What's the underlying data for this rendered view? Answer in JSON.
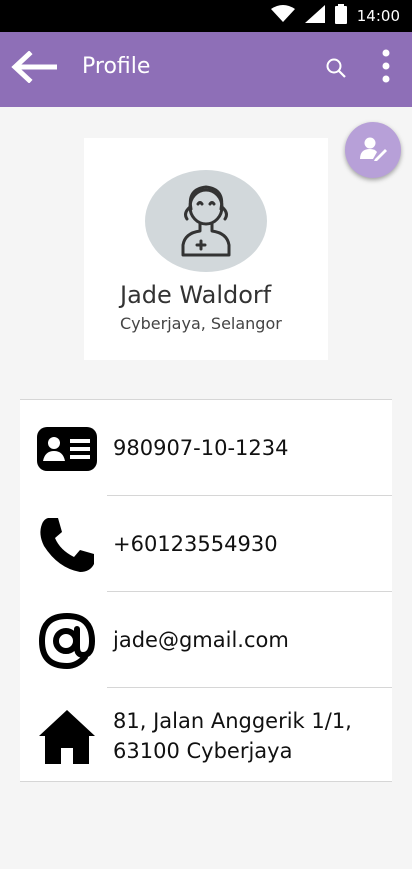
{
  "status_bar": {
    "time": "14:00"
  },
  "app_bar": {
    "title": "Profile"
  },
  "profile": {
    "name": "Jade Waldorf",
    "location": "Cyberjaya, Selangor"
  },
  "details": [
    {
      "icon": "id-card-icon",
      "value": "980907-10-1234"
    },
    {
      "icon": "phone-icon",
      "value": "+60123554930"
    },
    {
      "icon": "at-sign-icon",
      "value": "jade@gmail.com"
    },
    {
      "icon": "home-icon",
      "value": "81, Jalan Anggerik 1/1,\n63100 Cyberjaya"
    }
  ],
  "colors": {
    "app_bar": "#8e6fb7",
    "fab": "#b7a0d8",
    "avatar_bg": "#d2d8db",
    "background": "#f5f5f5"
  }
}
